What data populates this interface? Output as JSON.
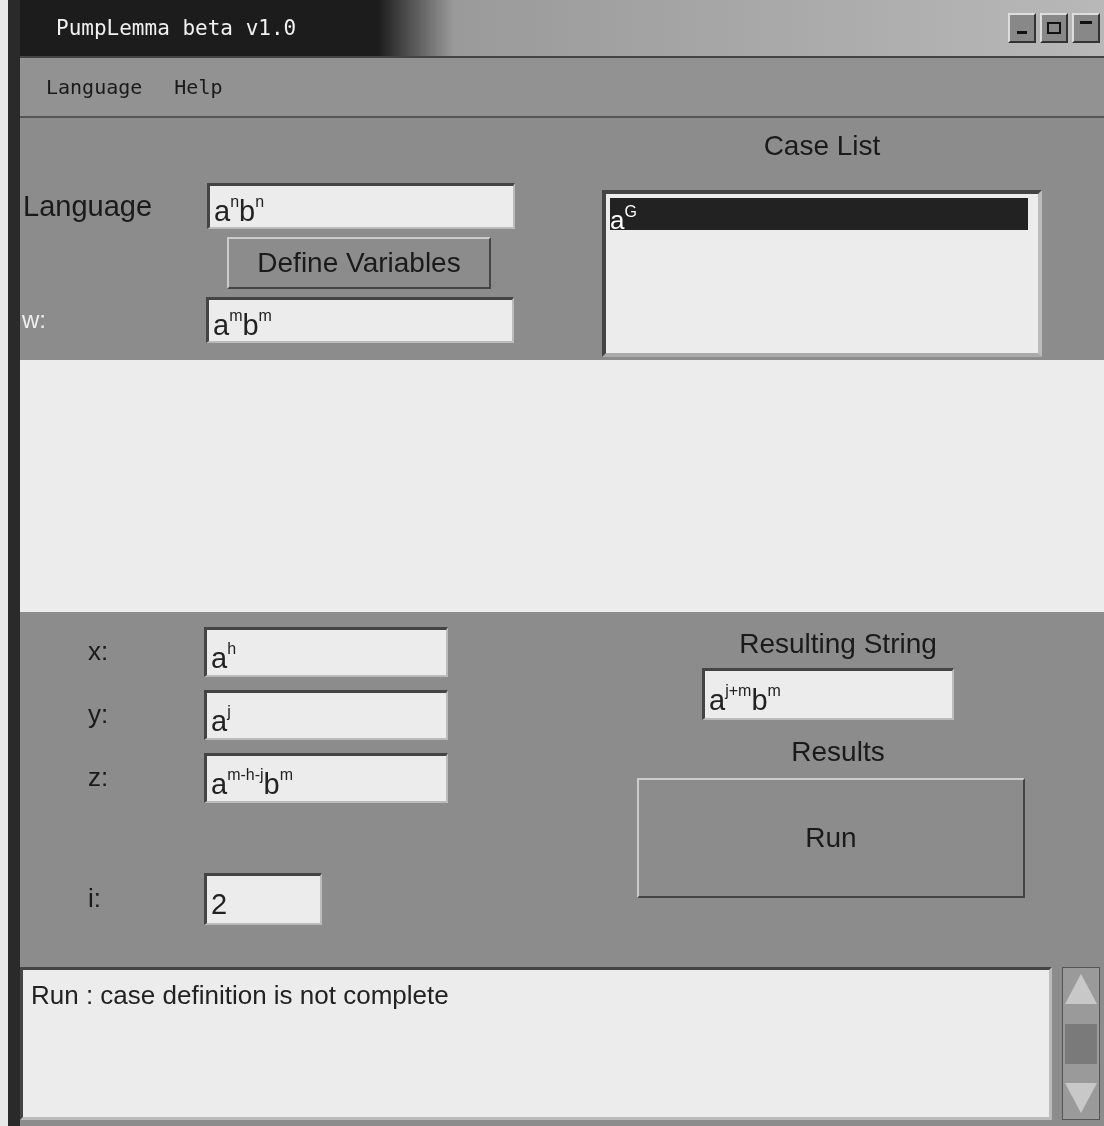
{
  "window": {
    "title": "PumpLemma beta v1.0",
    "controls": [
      {
        "kind": "minimize"
      },
      {
        "kind": "maximize"
      },
      {
        "kind": "close"
      }
    ]
  },
  "menu": [
    {
      "label": "Language"
    },
    {
      "label": "Help"
    }
  ],
  "language_field": {
    "label": "Language",
    "value": "a$^{n}$b$^{n}$"
  },
  "define_button": "Define Variables",
  "w_field": {
    "label": "w:",
    "value": "a$^{m}$b$^{m}$"
  },
  "case_list": {
    "title": "Case List",
    "items": [
      {
        "text": "a$^{G}$",
        "selected": true
      }
    ]
  },
  "decomposition": [
    {
      "label": "x:",
      "value": "a$^{h}$"
    },
    {
      "label": "y:",
      "value": "a$^{j}$"
    },
    {
      "label": "z:",
      "value": "a$^{m-h-j}$b$^{m}$"
    }
  ],
  "i_field": {
    "label": "i:",
    "value": "2"
  },
  "resulting_string": {
    "title": "Resulting String",
    "value": "a$^{j+m}$b$^{m}$"
  },
  "results": {
    "title": "Results",
    "run_button": "Run"
  },
  "message": "Run : case definition is not complete"
}
